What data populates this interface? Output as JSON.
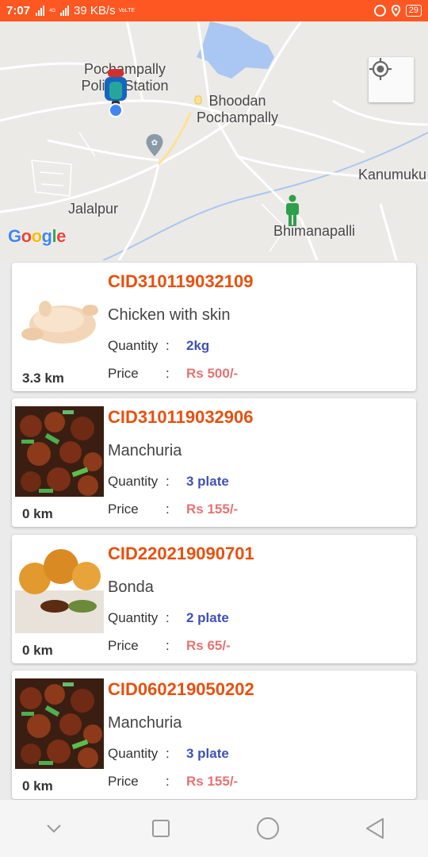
{
  "status_bar": {
    "time": "7:07",
    "net_small": "4G",
    "speed": "39 KB/s",
    "volte": "VoLTE",
    "battery": "29"
  },
  "map": {
    "labels": {
      "pochampally_police": "Pochampally Police Station",
      "pochampally_police_l1": "Pochampally",
      "pochampally_police_l2": "Police Station",
      "bhoodan_l1": "Bhoodan",
      "bhoodan_l2": "Pochampally",
      "kanumuku": "Kanumuku",
      "jalalpur": "Jalalpur",
      "bhimanapalli": "Bhimanapalli"
    },
    "logo": [
      "G",
      "o",
      "o",
      "g",
      "l",
      "e"
    ],
    "logo_colors": [
      "#4285F4",
      "#EA4335",
      "#FBBC05",
      "#4285F4",
      "#34A853",
      "#EA4335"
    ]
  },
  "labels": {
    "quantity": "Quantity",
    "price": "Price",
    "sep": ":"
  },
  "orders": [
    {
      "id": "CID310119032109",
      "name": "Chicken with skin",
      "quantity": "2kg",
      "price": "Rs 500/-",
      "distance": "3.3 km",
      "image": "chicken"
    },
    {
      "id": "CID310119032906",
      "name": "Manchuria",
      "quantity": "3 plate",
      "price": "Rs 155/-",
      "distance": "0 km",
      "image": "manchuria"
    },
    {
      "id": "CID220219090701",
      "name": "Bonda",
      "quantity": "2 plate",
      "price": "Rs 65/-",
      "distance": "0 km",
      "image": "bonda"
    },
    {
      "id": "CID060219050202",
      "name": "Manchuria",
      "quantity": "3 plate",
      "price": "Rs 155/-",
      "distance": "0 km",
      "image": "manchuria"
    }
  ],
  "colors": {
    "status_bar": "#ff5722",
    "order_id": "#e8500e",
    "quantity": "#3f51b5",
    "price": "#e57373"
  }
}
